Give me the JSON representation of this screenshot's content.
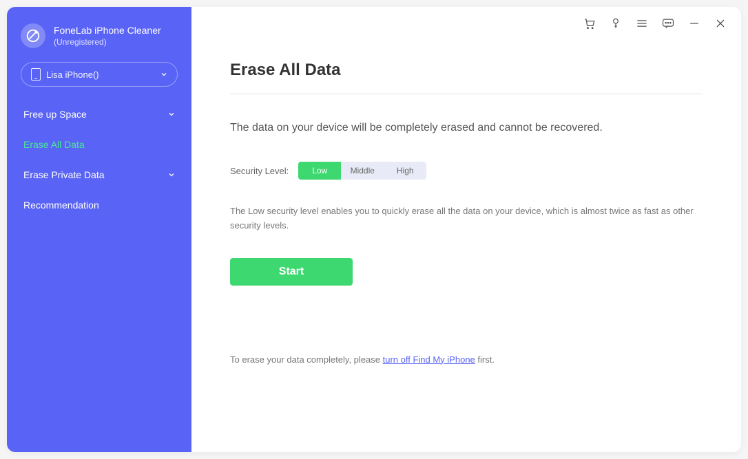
{
  "brand": {
    "title": "FoneLab iPhone Cleaner",
    "subtitle": "(Unregistered)"
  },
  "device": {
    "name": "Lisa iPhone()"
  },
  "nav": {
    "free_up_space": "Free up Space",
    "erase_all": "Erase All Data",
    "erase_private": "Erase Private Data",
    "recommendation": "Recommendation"
  },
  "page": {
    "title": "Erase All Data",
    "description": "The data on your device will be completely erased and cannot be recovered.",
    "security_label": "Security Level:",
    "security_options": {
      "low": "Low",
      "middle": "Middle",
      "high": "High"
    },
    "security_desc": "The Low security level enables you to quickly erase all the data on your device, which is almost twice as fast as other security levels.",
    "start_button": "Start",
    "footer_prefix": "To erase your data completely, please ",
    "footer_link": "turn off Find My iPhone",
    "footer_suffix": " first."
  }
}
